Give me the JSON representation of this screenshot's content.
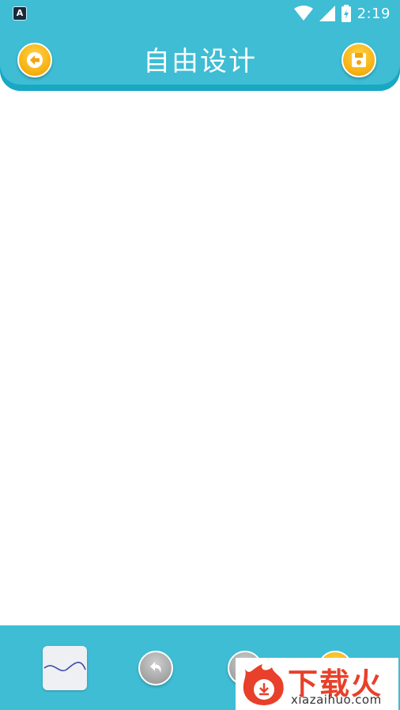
{
  "status_bar": {
    "app_icon_letter": "A",
    "time": "2:19",
    "icons": [
      "wifi-icon",
      "signal-icon",
      "battery-icon"
    ]
  },
  "header": {
    "title": "自由设计",
    "back_icon": "back-arrow-icon",
    "save_icon": "save-icon"
  },
  "toolbar": {
    "buttons": [
      "brush-select",
      "undo-icon",
      "redo-icon",
      "more-icon"
    ]
  },
  "watermark": {
    "chinese": "下载火",
    "latin": "xiazaihuo.com"
  },
  "colors": {
    "primary": "#3ebdd4",
    "primary_dark": "#18a8c4",
    "accent": "#f7b515",
    "watermark_red": "#e8402a"
  }
}
